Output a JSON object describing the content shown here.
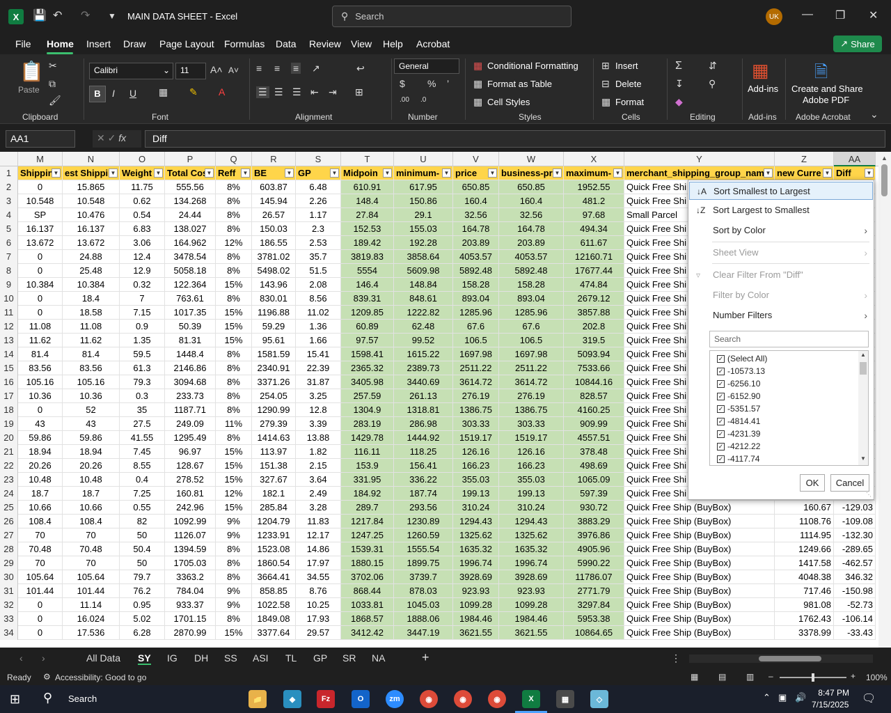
{
  "titlebar": {
    "doc_title": "MAIN DATA SHEET  -  Excel",
    "search_placeholder": "Search",
    "avatar": "UK"
  },
  "menu": [
    "File",
    "Home",
    "Insert",
    "Draw",
    "Page Layout",
    "Formulas",
    "Data",
    "Review",
    "View",
    "Help",
    "Acrobat"
  ],
  "share_label": "Share",
  "ribbon": {
    "clipboard": {
      "paste": "Paste",
      "label": "Clipboard"
    },
    "font": {
      "name": "Calibri",
      "size": "11",
      "label": "Font"
    },
    "alignment": {
      "label": "Alignment"
    },
    "number": {
      "format": "General",
      "label": "Number"
    },
    "styles": {
      "cond": "Conditional Formatting",
      "table": "Format as Table",
      "cell": "Cell Styles",
      "label": "Styles"
    },
    "cells": {
      "insert": "Insert",
      "delete": "Delete",
      "format": "Format",
      "label": "Cells"
    },
    "editing": {
      "label": "Editing"
    },
    "addins": {
      "btn": "Add-ins",
      "label": "Add-ins"
    },
    "acrobat": {
      "btn1": "Create and Share",
      "btn2": "Adobe PDF",
      "label": "Adobe Acrobat"
    }
  },
  "formula": {
    "namebox": "AA1",
    "fx": "fx",
    "value": "Diff"
  },
  "columns": [
    "M",
    "N",
    "O",
    "P",
    "Q",
    "R",
    "S",
    "T",
    "U",
    "V",
    "W",
    "X",
    "Y",
    "Z",
    "AA"
  ],
  "headers": [
    "Shippin",
    "est Shippi",
    "Weight",
    "Total Cos",
    "Reff",
    "BE",
    "GP",
    "Midpoin",
    "minimum-",
    "price",
    "business-pri",
    "maximum-",
    "merchant_shipping_group_nam",
    "new Curre",
    "Diff"
  ],
  "rows": [
    [
      "2",
      "0",
      "15.865",
      "11.75",
      "555.56",
      "8%",
      "603.87",
      "6.48",
      "610.91",
      "617.95",
      "650.85",
      "650.85",
      "1952.55",
      "Quick Free Shi",
      "",
      ""
    ],
    [
      "3",
      "10.548",
      "10.548",
      "0.62",
      "134.268",
      "8%",
      "145.94",
      "2.26",
      "148.4",
      "150.86",
      "160.4",
      "160.4",
      "481.2",
      "Quick Free Shi",
      "",
      ""
    ],
    [
      "4",
      "SP",
      "10.476",
      "0.54",
      "24.44",
      "8%",
      "26.57",
      "1.17",
      "27.84",
      "29.1",
      "32.56",
      "32.56",
      "97.68",
      "Small Parcel",
      "",
      ""
    ],
    [
      "5",
      "16.137",
      "16.137",
      "6.83",
      "138.027",
      "8%",
      "150.03",
      "2.3",
      "152.53",
      "155.03",
      "164.78",
      "164.78",
      "494.34",
      "Quick Free Shi",
      "",
      ""
    ],
    [
      "6",
      "13.672",
      "13.672",
      "3.06",
      "164.962",
      "12%",
      "186.55",
      "2.53",
      "189.42",
      "192.28",
      "203.89",
      "203.89",
      "611.67",
      "Quick Free Shi",
      "",
      ""
    ],
    [
      "7",
      "0",
      "24.88",
      "12.4",
      "3478.54",
      "8%",
      "3781.02",
      "35.7",
      "3819.83",
      "3858.64",
      "4053.57",
      "4053.57",
      "12160.71",
      "Quick Free Shi",
      "",
      ""
    ],
    [
      "8",
      "0",
      "25.48",
      "12.9",
      "5058.18",
      "8%",
      "5498.02",
      "51.5",
      "5554",
      "5609.98",
      "5892.48",
      "5892.48",
      "17677.44",
      "Quick Free Shi",
      "",
      ""
    ],
    [
      "9",
      "10.384",
      "10.384",
      "0.32",
      "122.364",
      "15%",
      "143.96",
      "2.08",
      "146.4",
      "148.84",
      "158.28",
      "158.28",
      "474.84",
      "Quick Free Shi",
      "",
      ""
    ],
    [
      "10",
      "0",
      "18.4",
      "7",
      "763.61",
      "8%",
      "830.01",
      "8.56",
      "839.31",
      "848.61",
      "893.04",
      "893.04",
      "2679.12",
      "Quick Free Shi",
      "",
      ""
    ],
    [
      "11",
      "0",
      "18.58",
      "7.15",
      "1017.35",
      "15%",
      "1196.88",
      "11.02",
      "1209.85",
      "1222.82",
      "1285.96",
      "1285.96",
      "3857.88",
      "Quick Free Shi",
      "",
      ""
    ],
    [
      "12",
      "11.08",
      "11.08",
      "0.9",
      "50.39",
      "15%",
      "59.29",
      "1.36",
      "60.89",
      "62.48",
      "67.6",
      "67.6",
      "202.8",
      "Quick Free Shi",
      "",
      ""
    ],
    [
      "13",
      "11.62",
      "11.62",
      "1.35",
      "81.31",
      "15%",
      "95.61",
      "1.66",
      "97.57",
      "99.52",
      "106.5",
      "106.5",
      "319.5",
      "Quick Free Shi",
      "",
      ""
    ],
    [
      "14",
      "81.4",
      "81.4",
      "59.5",
      "1448.4",
      "8%",
      "1581.59",
      "15.41",
      "1598.41",
      "1615.22",
      "1697.98",
      "1697.98",
      "5093.94",
      "Quick Free Shi",
      "",
      ""
    ],
    [
      "15",
      "83.56",
      "83.56",
      "61.3",
      "2146.86",
      "8%",
      "2340.91",
      "22.39",
      "2365.32",
      "2389.73",
      "2511.22",
      "2511.22",
      "7533.66",
      "Quick Free Shi",
      "",
      ""
    ],
    [
      "16",
      "105.16",
      "105.16",
      "79.3",
      "3094.68",
      "8%",
      "3371.26",
      "31.87",
      "3405.98",
      "3440.69",
      "3614.72",
      "3614.72",
      "10844.16",
      "Quick Free Shi",
      "",
      ""
    ],
    [
      "17",
      "10.36",
      "10.36",
      "0.3",
      "233.73",
      "8%",
      "254.05",
      "3.25",
      "257.59",
      "261.13",
      "276.19",
      "276.19",
      "828.57",
      "Quick Free Shi",
      "",
      ""
    ],
    [
      "18",
      "0",
      "52",
      "35",
      "1187.71",
      "8%",
      "1290.99",
      "12.8",
      "1304.9",
      "1318.81",
      "1386.75",
      "1386.75",
      "4160.25",
      "Quick Free Shi",
      "",
      ""
    ],
    [
      "19",
      "43",
      "43",
      "27.5",
      "249.09",
      "11%",
      "279.39",
      "3.39",
      "283.19",
      "286.98",
      "303.33",
      "303.33",
      "909.99",
      "Quick Free Shi",
      "",
      ""
    ],
    [
      "20",
      "59.86",
      "59.86",
      "41.55",
      "1295.49",
      "8%",
      "1414.63",
      "13.88",
      "1429.78",
      "1444.92",
      "1519.17",
      "1519.17",
      "4557.51",
      "Quick Free Shi",
      "",
      ""
    ],
    [
      "21",
      "18.94",
      "18.94",
      "7.45",
      "96.97",
      "15%",
      "113.97",
      "1.82",
      "116.11",
      "118.25",
      "126.16",
      "126.16",
      "378.48",
      "Quick Free Shi",
      "",
      ""
    ],
    [
      "22",
      "20.26",
      "20.26",
      "8.55",
      "128.67",
      "15%",
      "151.38",
      "2.15",
      "153.9",
      "156.41",
      "166.23",
      "166.23",
      "498.69",
      "Quick Free Shi",
      "",
      ""
    ],
    [
      "23",
      "10.48",
      "10.48",
      "0.4",
      "278.52",
      "15%",
      "327.67",
      "3.64",
      "331.95",
      "336.22",
      "355.03",
      "355.03",
      "1065.09",
      "Quick Free Shi",
      "",
      ""
    ],
    [
      "24",
      "18.7",
      "18.7",
      "7.25",
      "160.81",
      "12%",
      "182.1",
      "2.49",
      "184.92",
      "187.74",
      "199.13",
      "199.13",
      "597.39",
      "Quick Free Shi",
      "",
      ""
    ],
    [
      "25",
      "10.66",
      "10.66",
      "0.55",
      "242.96",
      "15%",
      "285.84",
      "3.28",
      "289.7",
      "293.56",
      "310.24",
      "310.24",
      "930.72",
      "Quick Free Ship (BuyBox)",
      "160.67",
      "-129.03"
    ],
    [
      "26",
      "108.4",
      "108.4",
      "82",
      "1092.99",
      "9%",
      "1204.79",
      "11.83",
      "1217.84",
      "1230.89",
      "1294.43",
      "1294.43",
      "3883.29",
      "Quick Free Ship (BuyBox)",
      "1108.76",
      "-109.08"
    ],
    [
      "27",
      "70",
      "70",
      "50",
      "1126.07",
      "9%",
      "1233.91",
      "12.17",
      "1247.25",
      "1260.59",
      "1325.62",
      "1325.62",
      "3976.86",
      "Quick Free Ship (BuyBox)",
      "1114.95",
      "-132.30"
    ],
    [
      "28",
      "70.48",
      "70.48",
      "50.4",
      "1394.59",
      "8%",
      "1523.08",
      "14.86",
      "1539.31",
      "1555.54",
      "1635.32",
      "1635.32",
      "4905.96",
      "Quick Free Ship (BuyBox)",
      "1249.66",
      "-289.65"
    ],
    [
      "29",
      "70",
      "70",
      "50",
      "1705.03",
      "8%",
      "1860.54",
      "17.97",
      "1880.15",
      "1899.75",
      "1996.74",
      "1996.74",
      "5990.22",
      "Quick Free Ship (BuyBox)",
      "1417.58",
      "-462.57"
    ],
    [
      "30",
      "105.64",
      "105.64",
      "79.7",
      "3363.2",
      "8%",
      "3664.41",
      "34.55",
      "3702.06",
      "3739.7",
      "3928.69",
      "3928.69",
      "11786.07",
      "Quick Free Ship (BuyBox)",
      "4048.38",
      "346.32"
    ],
    [
      "31",
      "101.44",
      "101.44",
      "76.2",
      "784.04",
      "9%",
      "858.85",
      "8.76",
      "868.44",
      "878.03",
      "923.93",
      "923.93",
      "2771.79",
      "Quick Free Ship (BuyBox)",
      "717.46",
      "-150.98"
    ],
    [
      "32",
      "0",
      "11.14",
      "0.95",
      "933.37",
      "9%",
      "1022.58",
      "10.25",
      "1033.81",
      "1045.03",
      "1099.28",
      "1099.28",
      "3297.84",
      "Quick Free Ship (BuyBox)",
      "981.08",
      "-52.73"
    ],
    [
      "33",
      "0",
      "16.024",
      "5.02",
      "1701.15",
      "8%",
      "1849.08",
      "17.93",
      "1868.57",
      "1888.06",
      "1984.46",
      "1984.46",
      "5953.38",
      "Quick Free Ship (BuyBox)",
      "1762.43",
      "-106.14"
    ],
    [
      "34",
      "0",
      "17.536",
      "6.28",
      "2870.99",
      "15%",
      "3377.64",
      "29.57",
      "3412.42",
      "3447.19",
      "3621.55",
      "3621.55",
      "10864.65",
      "Quick Free Ship (BuyBox)",
      "3378.99",
      "-33.43"
    ]
  ],
  "dropdown": {
    "sort_asc": "Sort Smallest to Largest",
    "sort_desc": "Sort Largest to Smallest",
    "sort_color": "Sort by Color",
    "sheet_view": "Sheet View",
    "clear_filter": "Clear Filter From \"Diff\"",
    "filter_color": "Filter by Color",
    "number_filters": "Number Filters",
    "search_placeholder": "Search",
    "items": [
      "(Select All)",
      "-10573.13",
      "-6256.10",
      "-6152.90",
      "-5351.57",
      "-4814.41",
      "-4231.39",
      "-4212.22",
      "-4117.74"
    ],
    "ok": "OK",
    "cancel": "Cancel"
  },
  "sheets": [
    "All Data",
    "SY",
    "IG",
    "DH",
    "SS",
    "ASI",
    "TL",
    "GP",
    "SR",
    "NA"
  ],
  "active_sheet": "SY",
  "status": {
    "ready": "Ready",
    "accessibility": "Accessibility: Good to go",
    "zoom": "100%"
  },
  "taskbar": {
    "search": "Search",
    "time": "8:47 PM",
    "date": "7/15/2025"
  }
}
